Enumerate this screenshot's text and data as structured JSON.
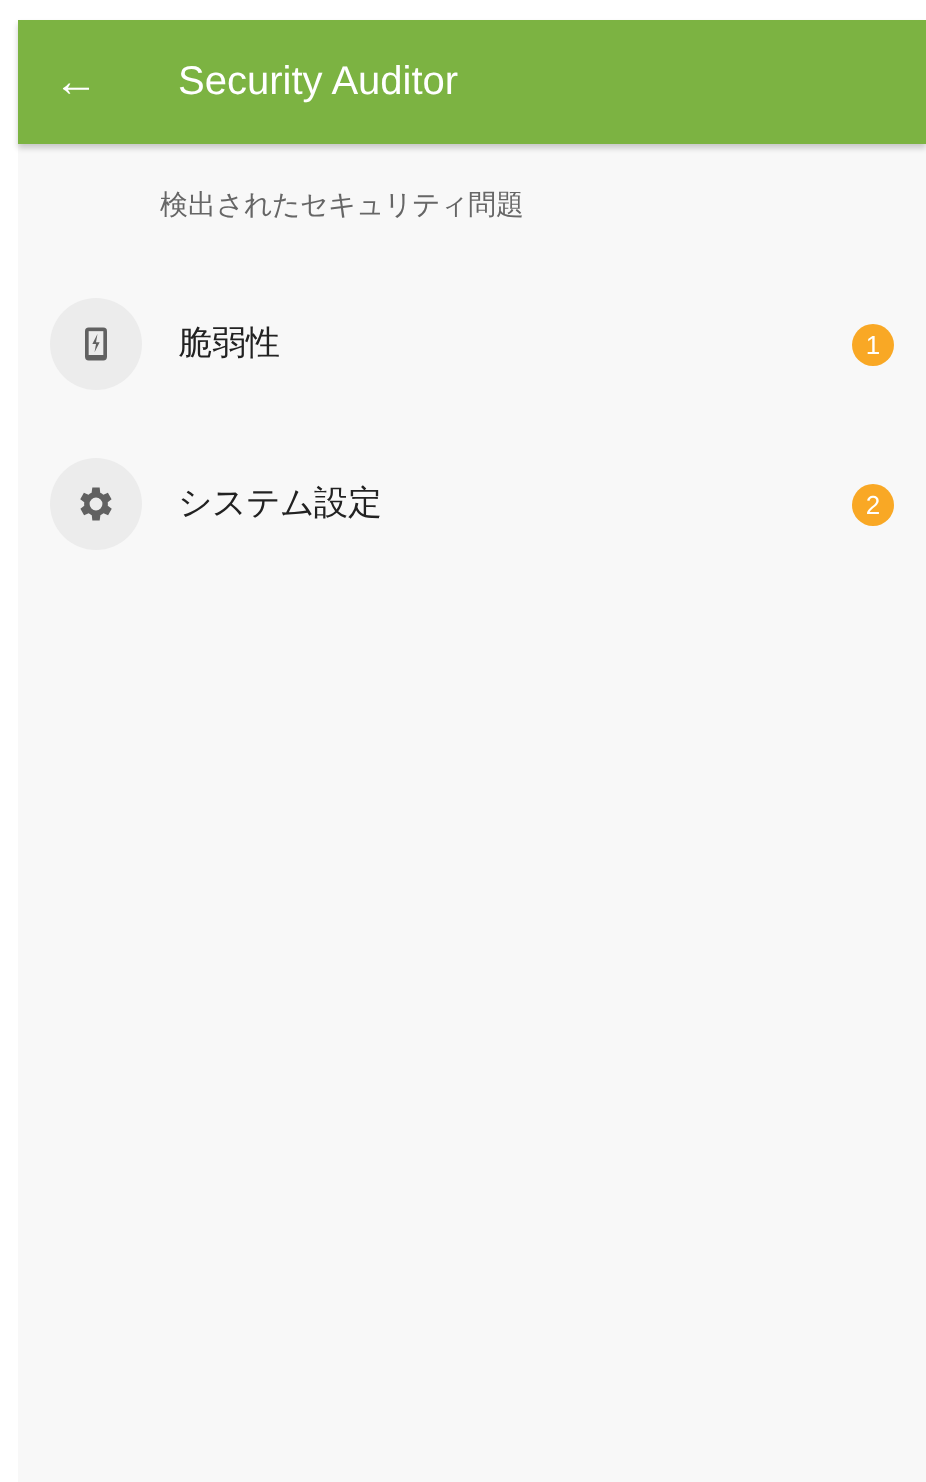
{
  "toolbar": {
    "back_icon": "←",
    "title": "Security Auditor"
  },
  "section_header": "検出されたセキュリティ問題",
  "items": [
    {
      "kind": "phone",
      "label": "脆弱性",
      "count": "1"
    },
    {
      "kind": "gear",
      "label": "システム設定",
      "count": "2"
    }
  ]
}
